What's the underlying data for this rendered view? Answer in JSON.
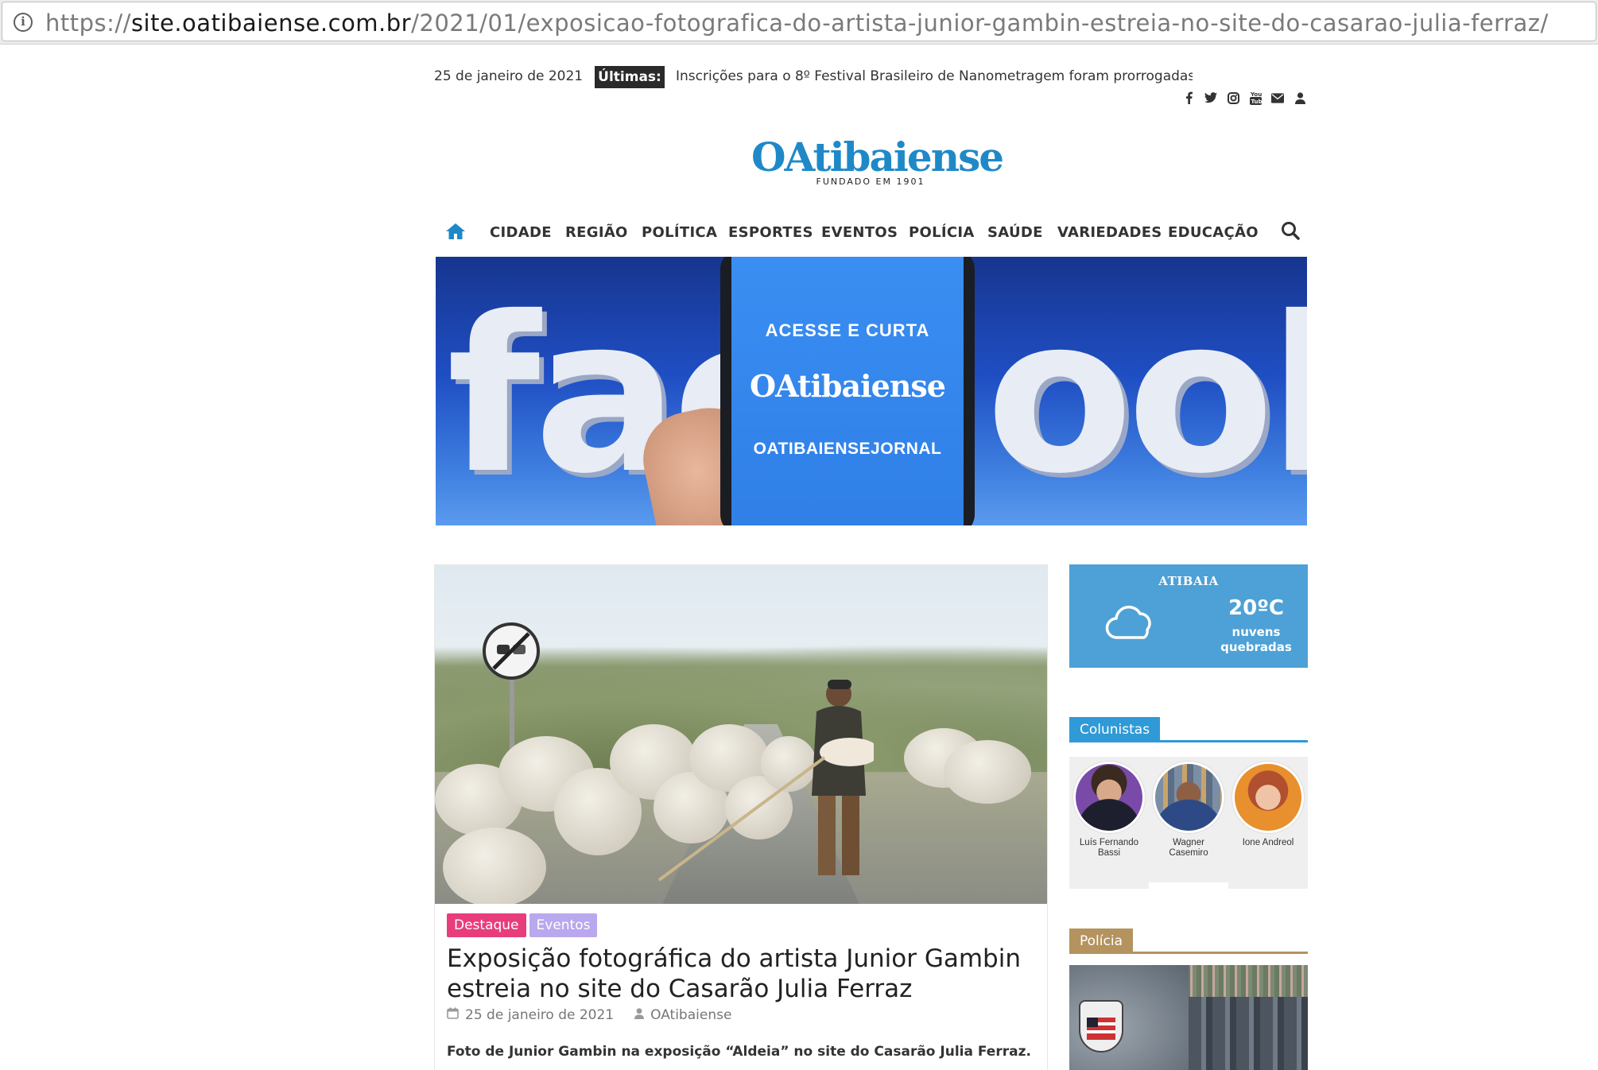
{
  "browser": {
    "url_prefix": "https://",
    "url_host": "site.oatibaiense.com.br",
    "url_path": "/2021/01/exposicao-fotografica-do-artista-junior-gambin-estreia-no-site-do-casarao-julia-ferraz/"
  },
  "topbar": {
    "date": "25 de janeiro de 2021",
    "ticker_label": "Últimas:",
    "ticker_text": "Inscrições para o 8º Festival Brasileiro de Nanometragem foram prorrogadas",
    "social_icons": [
      "facebook-icon",
      "twitter-icon",
      "instagram-icon",
      "youtube-icon",
      "envelope-icon",
      "user-icon"
    ]
  },
  "logo": {
    "name": "OAtibaiense",
    "tagline": "FUNDADO EM 1901"
  },
  "nav": {
    "items": [
      "CIDADE",
      "REGIÃO",
      "POLÍTICA",
      "ESPORTES",
      "EVENTOS",
      "POLÍCIA",
      "SAÚDE",
      "VARIEDADES",
      "EDUCAÇÃO"
    ],
    "accent": "#1f89c8"
  },
  "banner": {
    "bg_word_left": "fac",
    "bg_word_right": "ook",
    "line1": "ACESSE E CURTA",
    "logo": "OAtibaiense",
    "line3": "OATIBAIENSEJORNAL"
  },
  "article": {
    "tags": [
      "Destaque",
      "Eventos"
    ],
    "title": "Exposição fotográfica do artista Junior Gambin estreia no site do Casarão Julia Ferraz",
    "date": "25 de janeiro de 2021",
    "author": "OAtibaiense",
    "excerpt": "Foto de Junior Gambin na exposição “Aldeia” no site do Casarão Julia Ferraz."
  },
  "weather": {
    "city": "ATIBAIA",
    "temperature": "20ºC",
    "condition_line1": "nuvens",
    "condition_line2": "quebradas"
  },
  "columnists": {
    "title": "Colunistas",
    "people": [
      {
        "name": "Luís Fernando Bassi"
      },
      {
        "name": "Wagner Casemiro"
      },
      {
        "name": "Ione Andreol"
      }
    ]
  },
  "police_widget": {
    "title": "Polícia"
  },
  "colors": {
    "tag_destaque": "#e83d7b",
    "tag_eventos": "#b9a8ee",
    "weather_bg": "#4da1d6",
    "colunistas_accent": "#2f9ad6",
    "policia_accent": "#b4935f"
  }
}
